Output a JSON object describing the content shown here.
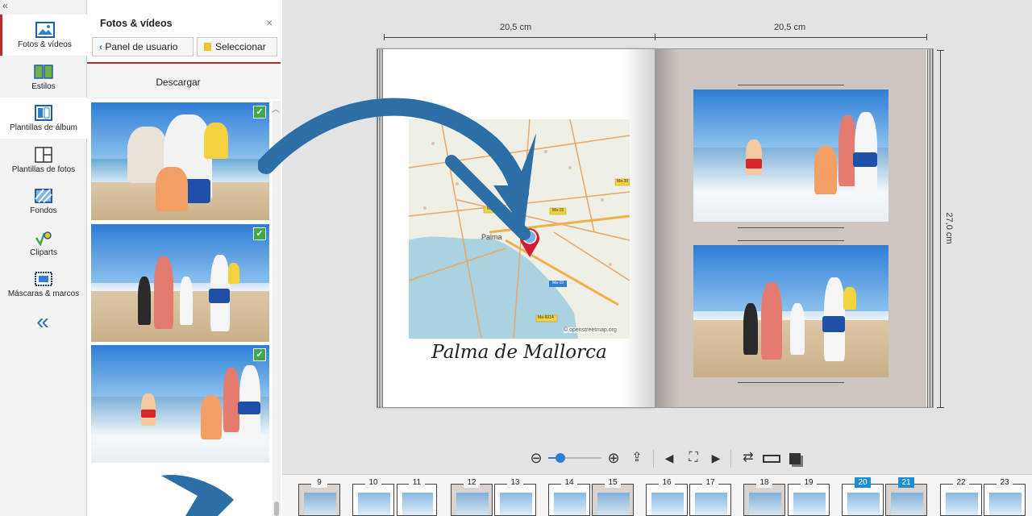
{
  "nav": {
    "collapse_top": "«",
    "items": [
      {
        "label": "Fotos & vídeos",
        "icon": "photo-icon"
      },
      {
        "label": "Estilos",
        "icon": "styles-icon"
      },
      {
        "label": "Plantillas de álbum",
        "icon": "album-template-icon"
      },
      {
        "label": "Plantillas de fotos",
        "icon": "photo-template-icon"
      },
      {
        "label": "Fondos",
        "icon": "backgrounds-icon"
      },
      {
        "label": "Cliparts",
        "icon": "cliparts-icon"
      },
      {
        "label": "Máscaras & marcos",
        "icon": "masks-frames-icon"
      }
    ],
    "collapse_bottom": "«"
  },
  "panel": {
    "title": "Fotos & vídeos",
    "close": "×",
    "back_button": "Panel de usuario",
    "select_button": "Seleccionar",
    "download": "Descargar",
    "check": "✓"
  },
  "book": {
    "left_width": "20,5 cm",
    "right_width": "20,5 cm",
    "height": "27,0 cm",
    "caption": "Palma de Mallorca",
    "map": {
      "city": "Palma",
      "credit": "© openstreetmap.org",
      "roads": [
        "Ma-13",
        "Ma-15",
        "Ma-19",
        "Ma-6014",
        "Ma-30"
      ]
    }
  },
  "toolbar": {
    "zoom_value": 0.2
  },
  "pages": {
    "numbers": [
      "9",
      "10",
      "11",
      "12",
      "13",
      "14",
      "15",
      "16",
      "17",
      "18",
      "19",
      "20",
      "21",
      "22",
      "23"
    ],
    "selected": [
      "20",
      "21"
    ]
  },
  "colors": {
    "accent_red": "#c0262d",
    "accent_blue": "#2d6fb0",
    "check_green": "#3fa84a",
    "page_selected": "#1b8ed8"
  }
}
